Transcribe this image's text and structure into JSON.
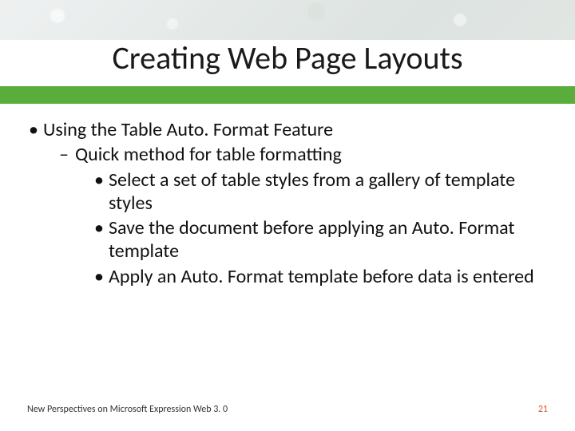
{
  "title": "Creating Web Page Layouts",
  "bullets": {
    "l1": "Using the Table Auto. Format Feature",
    "l2": "Quick method for table formatting",
    "l3a": "Select a set of table styles from a gallery of template styles",
    "l3b": "Save the document before applying an Auto. Format template",
    "l3c": "Apply an Auto. Format template before data is entered"
  },
  "footer": {
    "left": "New Perspectives on Microsoft Expression Web 3. 0",
    "page": "21"
  },
  "colors": {
    "accent_bar": "#5aad3a",
    "page_number": "#d05a2a"
  }
}
